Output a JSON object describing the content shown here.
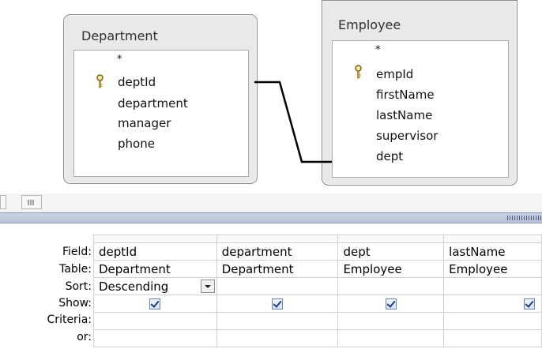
{
  "tables": [
    {
      "title": "Department",
      "fields": [
        "*",
        "deptId",
        "department",
        "manager",
        "phone"
      ],
      "primary_key": "deptId"
    },
    {
      "title": "Employee",
      "fields": [
        "*",
        "empId",
        "firstName",
        "lastName",
        "supervisor",
        "dept"
      ],
      "primary_key": "empId"
    }
  ],
  "relationship": {
    "from": "Department.deptId",
    "to": "Employee.dept"
  },
  "grid": {
    "row_labels": [
      "Field:",
      "Table:",
      "Sort:",
      "Show:",
      "Criteria:",
      "or:"
    ],
    "columns": [
      {
        "field": "deptId",
        "table": "Department",
        "sort": "Descending",
        "show": true
      },
      {
        "field": "department",
        "table": "Department",
        "sort": "",
        "show": true
      },
      {
        "field": "dept",
        "table": "Employee",
        "sort": "",
        "show": true
      },
      {
        "field": "lastName",
        "table": "Employee",
        "sort": "",
        "show": true
      }
    ]
  },
  "icons": [
    "key-icon",
    "dropdown-arrow-icon",
    "checkbox-checked-icon",
    "splitter-grip-icon"
  ]
}
